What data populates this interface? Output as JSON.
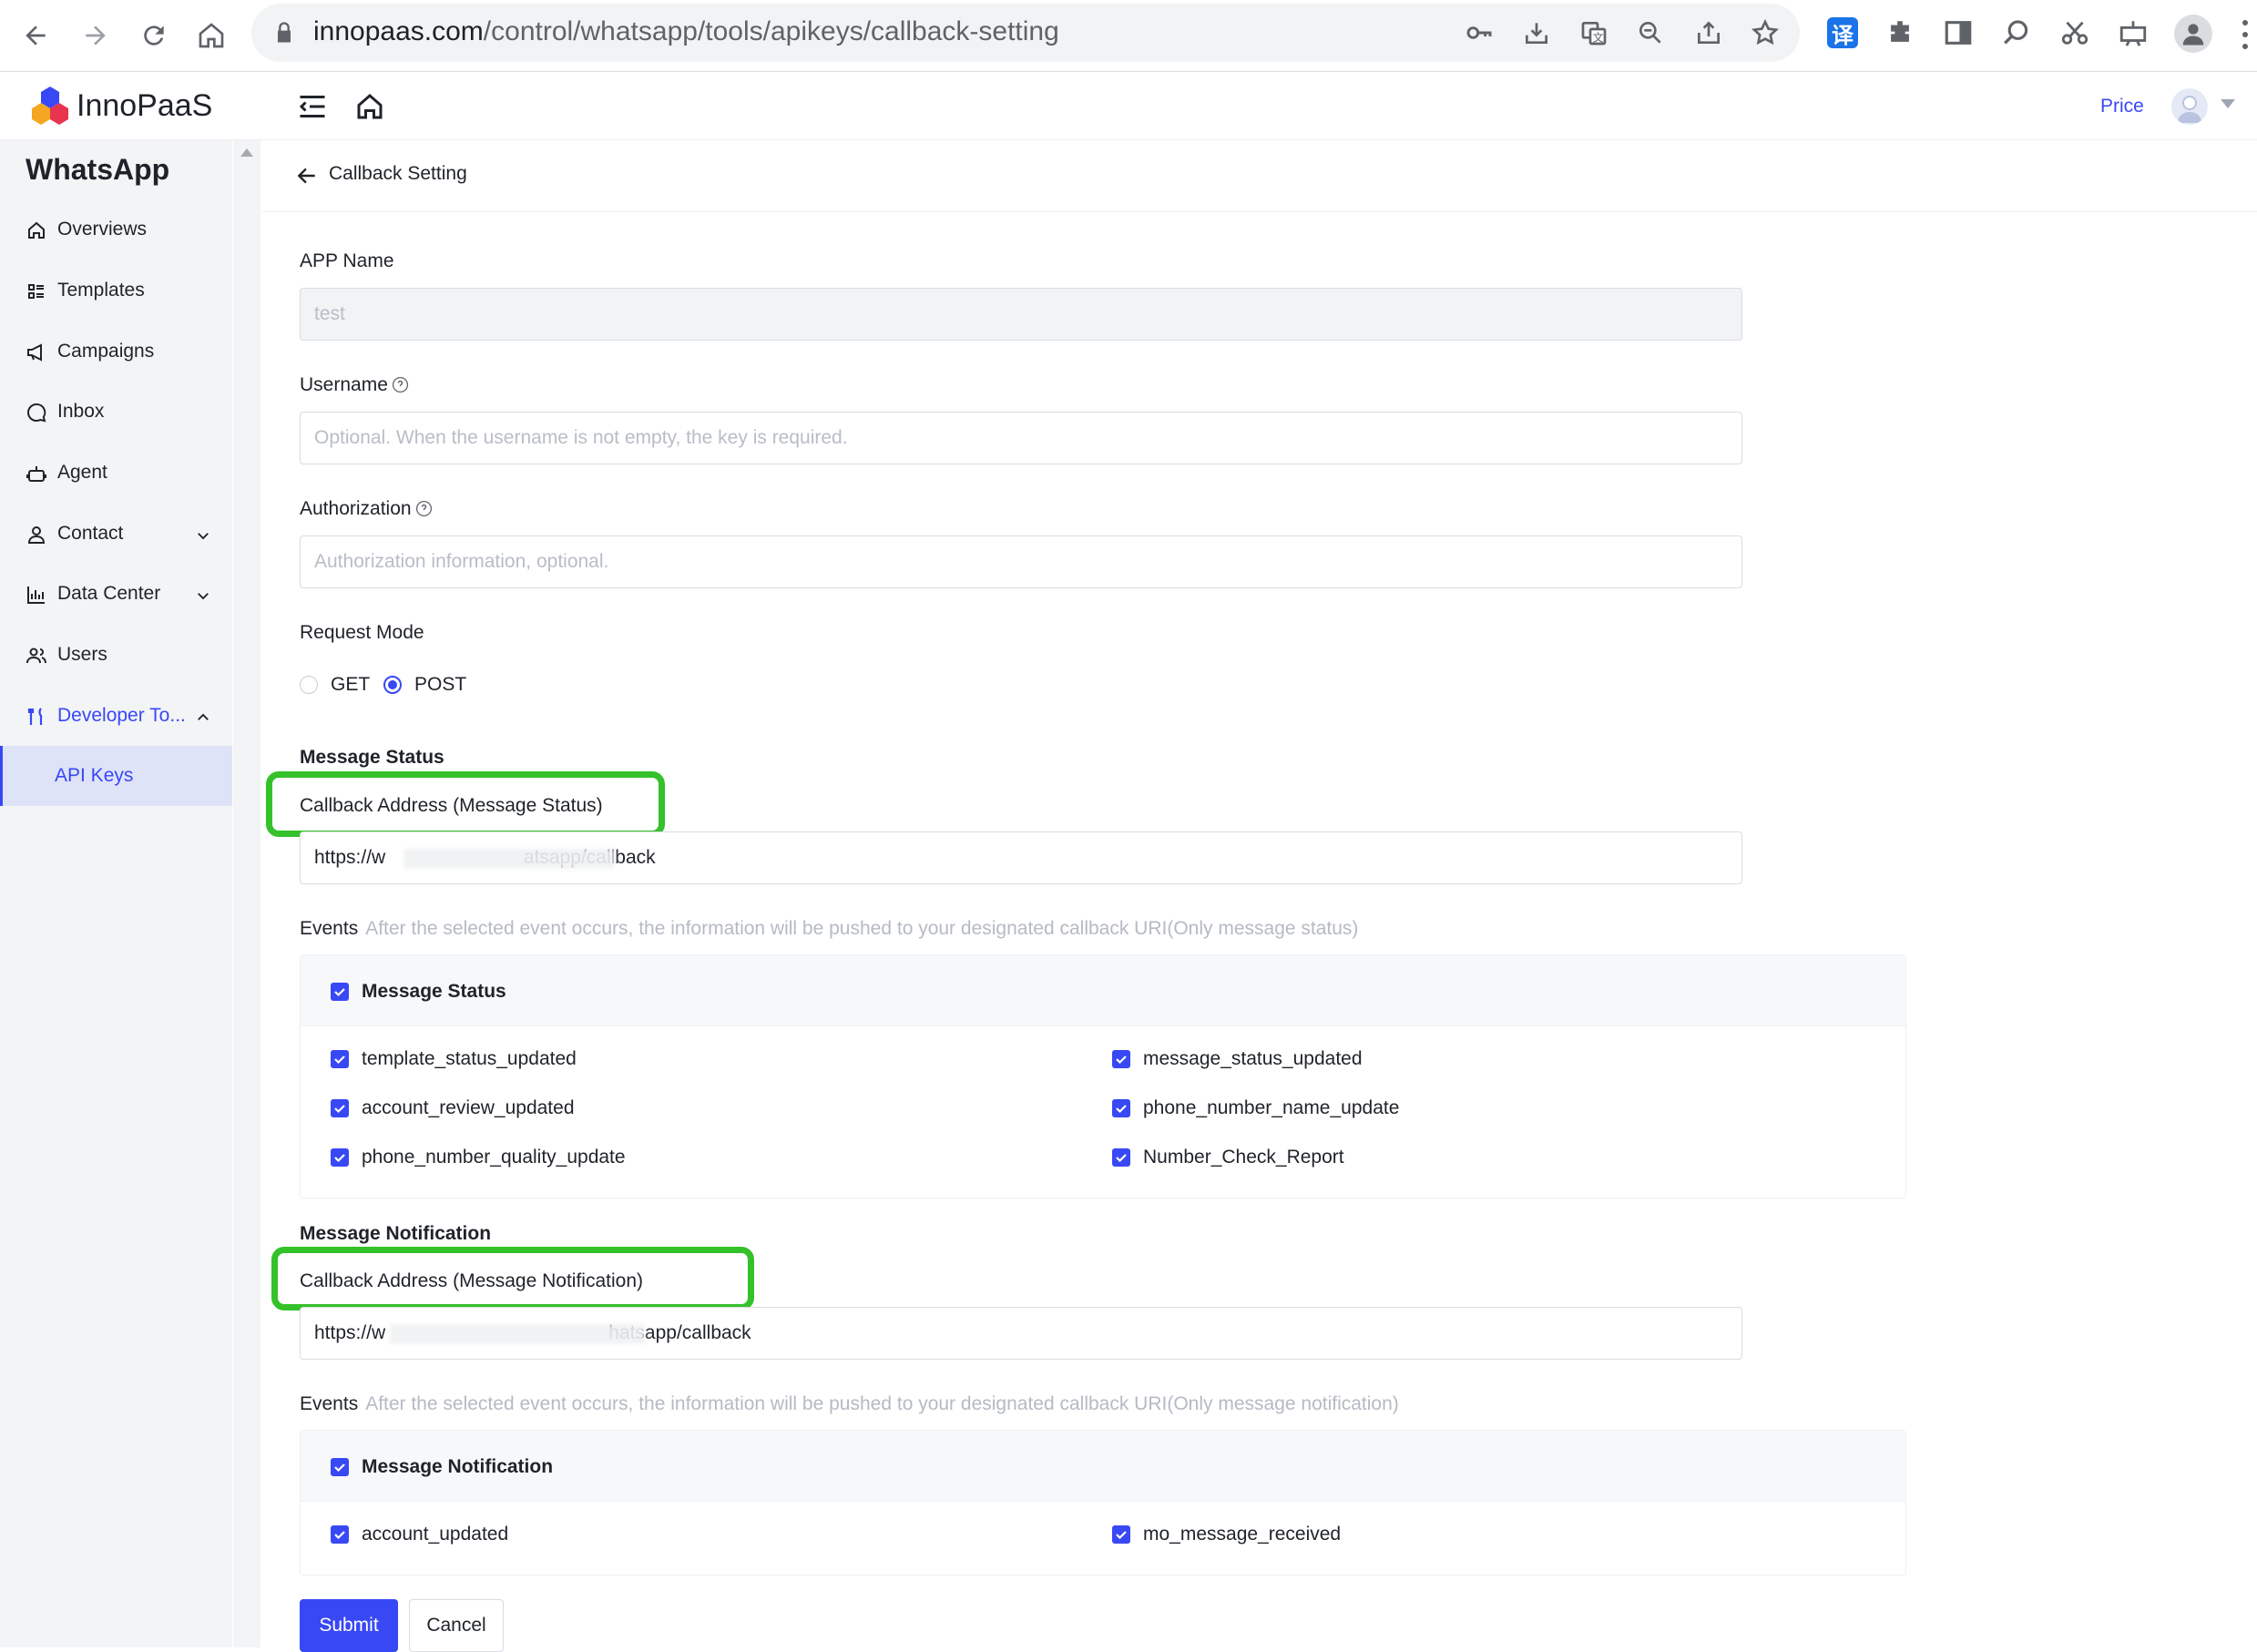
{
  "browser": {
    "url_host": "innopaas.com",
    "url_path": "/control/whatsapp/tools/apikeys/callback-setting",
    "translate_badge": "译"
  },
  "app": {
    "logo_text": "InnoPaaS",
    "price_link": "Price"
  },
  "sidebar": {
    "title": "WhatsApp",
    "items": [
      {
        "label": "Overviews",
        "icon": "home-icon"
      },
      {
        "label": "Templates",
        "icon": "list-icon"
      },
      {
        "label": "Campaigns",
        "icon": "megaphone-icon"
      },
      {
        "label": "Inbox",
        "icon": "chat-icon"
      },
      {
        "label": "Agent",
        "icon": "robot-icon"
      },
      {
        "label": "Contact",
        "icon": "user-icon"
      },
      {
        "label": "Data Center",
        "icon": "chart-icon"
      },
      {
        "label": "Users",
        "icon": "users-icon"
      },
      {
        "label": "Developer To...",
        "icon": "tools-icon"
      }
    ],
    "sub_item": "API Keys"
  },
  "page": {
    "title": "Callback Setting",
    "app_name": {
      "label": "APP Name",
      "value": "test"
    },
    "username": {
      "label": "Username",
      "placeholder": "Optional. When the username is not empty, the key is required."
    },
    "authorization": {
      "label": "Authorization",
      "placeholder": "Authorization information, optional."
    },
    "request_mode": {
      "label": "Request Mode",
      "options": [
        "GET",
        "POST"
      ],
      "selected": "POST"
    },
    "message_status": {
      "heading": "Message Status",
      "callback_label": "Callback Address (Message Status)",
      "callback_value": "https://w                          atsapp/callback",
      "events_label": "Events",
      "events_hint": "After the selected event occurs, the information will be pushed to your designated callback URI(Only message status)",
      "group": "Message Status",
      "events": [
        "template_status_updated",
        "message_status_updated",
        "account_review_updated",
        "phone_number_name_update",
        "phone_number_quality_update",
        "Number_Check_Report"
      ]
    },
    "message_notification": {
      "heading": "Message Notification",
      "callback_label": "Callback Address (Message Notification)",
      "callback_value": "https://w                                          hatsapp/callback",
      "events_label": "Events",
      "events_hint": "After the selected event occurs, the information will be pushed to your designated callback URI(Only message notification)",
      "group": "Message Notification",
      "events": [
        "account_updated",
        "mo_message_received"
      ]
    },
    "submit_label": "Submit",
    "cancel_label": "Cancel"
  },
  "colors": {
    "accent": "#3848f5",
    "highlight": "#34c12a",
    "sidebar_bg": "#f3f4f6"
  }
}
